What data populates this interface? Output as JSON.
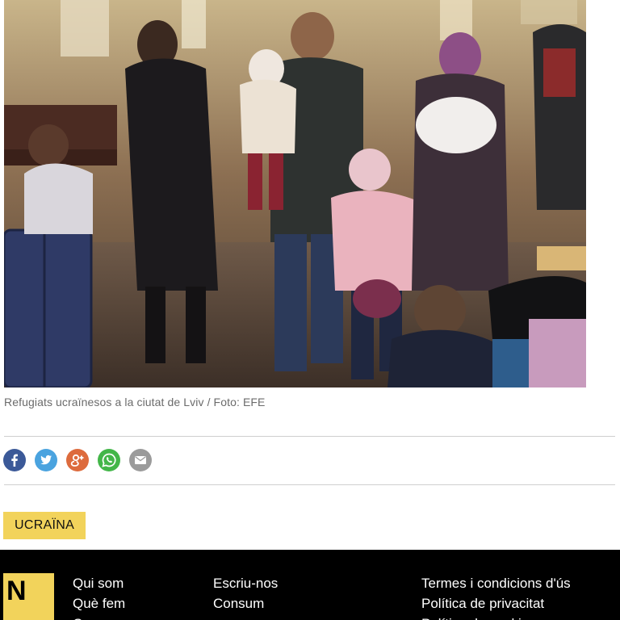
{
  "photo": {
    "alt": "Refugiats ucraïnesos a la ciutat de Lviv"
  },
  "caption": "Refugiats ucraïnesos a la ciutat de Lviv / Foto: EFE",
  "share": {
    "buttons": [
      {
        "network": "facebook",
        "icon": "facebook-icon",
        "color": "#3b5998"
      },
      {
        "network": "twitter",
        "icon": "twitter-icon",
        "color": "#4aa3df"
      },
      {
        "network": "google-plus",
        "icon": "google-plus-icon",
        "color": "#dd6b3d"
      },
      {
        "network": "whatsapp",
        "icon": "whatsapp-icon",
        "color": "#43b649"
      },
      {
        "network": "email",
        "icon": "email-icon",
        "color": "#9b9b9b"
      }
    ]
  },
  "tag": {
    "label": "UCRAÏNA",
    "color": "#f2d35b"
  },
  "footer": {
    "logo_letter": "N",
    "logo_color": "#f2d35b",
    "col1": [
      "Qui som",
      "Què fem",
      "Qu"
    ],
    "col2": [
      "Escriu-nos",
      "Consum"
    ],
    "col3": [
      "Termes i condicions d'ús",
      "Política de privacitat",
      "Política de cookies"
    ]
  }
}
